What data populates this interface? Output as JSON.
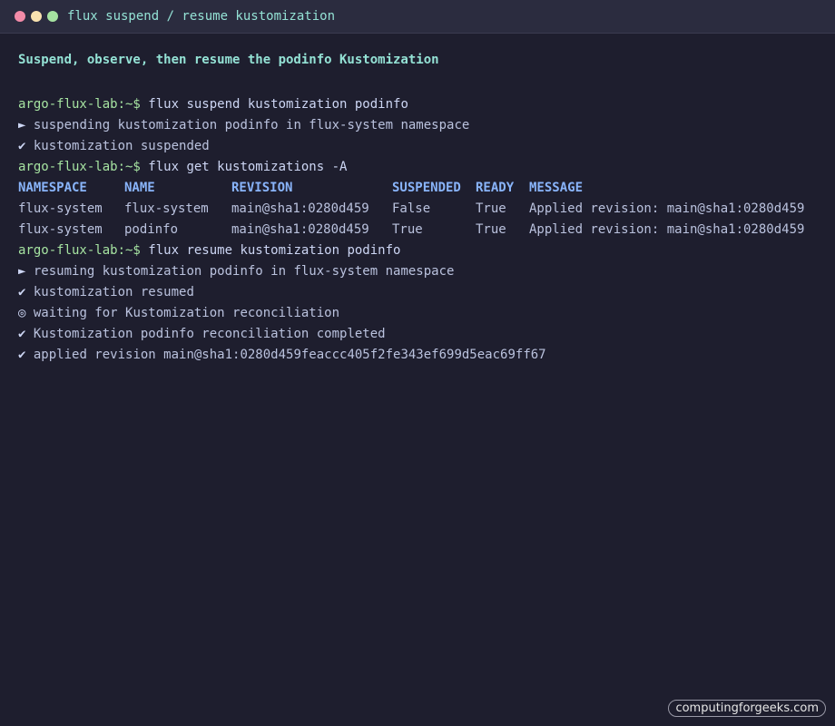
{
  "window": {
    "title": "flux suspend / resume kustomization",
    "colors": {
      "background": "#1e1e2e",
      "titlebar": "#2b2c3f",
      "prompt": "#a6e3a1",
      "heading": "#94e2d5",
      "table_header": "#89b4fa"
    }
  },
  "heading": "Suspend, observe, then resume the podinfo Kustomization",
  "prompt": "argo-flux-lab:~$",
  "commands": {
    "c1": "flux suspend kustomization podinfo",
    "c2": "flux get kustomizations -A",
    "c3": "flux resume kustomization podinfo"
  },
  "output": {
    "o1_mark": "►",
    "o1": "suspending kustomization podinfo in flux-system namespace",
    "o2_mark": "✔",
    "o2": "kustomization suspended",
    "o3_mark": "►",
    "o3": "resuming kustomization podinfo in flux-system namespace",
    "o4_mark": "✔",
    "o4": "kustomization resumed",
    "o5_mark": "◎",
    "o5": "waiting for Kustomization reconciliation",
    "o6_mark": "✔",
    "o6": "Kustomization podinfo reconciliation completed",
    "o7_mark": "✔",
    "o7": "applied revision main@sha1:0280d459feaccc405f2fe343ef699d5eac69ff67"
  },
  "table": {
    "headers": [
      "NAMESPACE",
      "NAME",
      "REVISION",
      "SUSPENDED",
      "READY",
      "MESSAGE"
    ],
    "rows": [
      [
        "flux-system",
        "flux-system",
        "main@sha1:0280d459",
        "False",
        "True",
        "Applied revision: main@sha1:0280d459"
      ],
      [
        "flux-system",
        "podinfo",
        "main@sha1:0280d459",
        "True",
        "True",
        "Applied revision: main@sha1:0280d459"
      ]
    ]
  },
  "watermark": "computingforgeeks.com"
}
